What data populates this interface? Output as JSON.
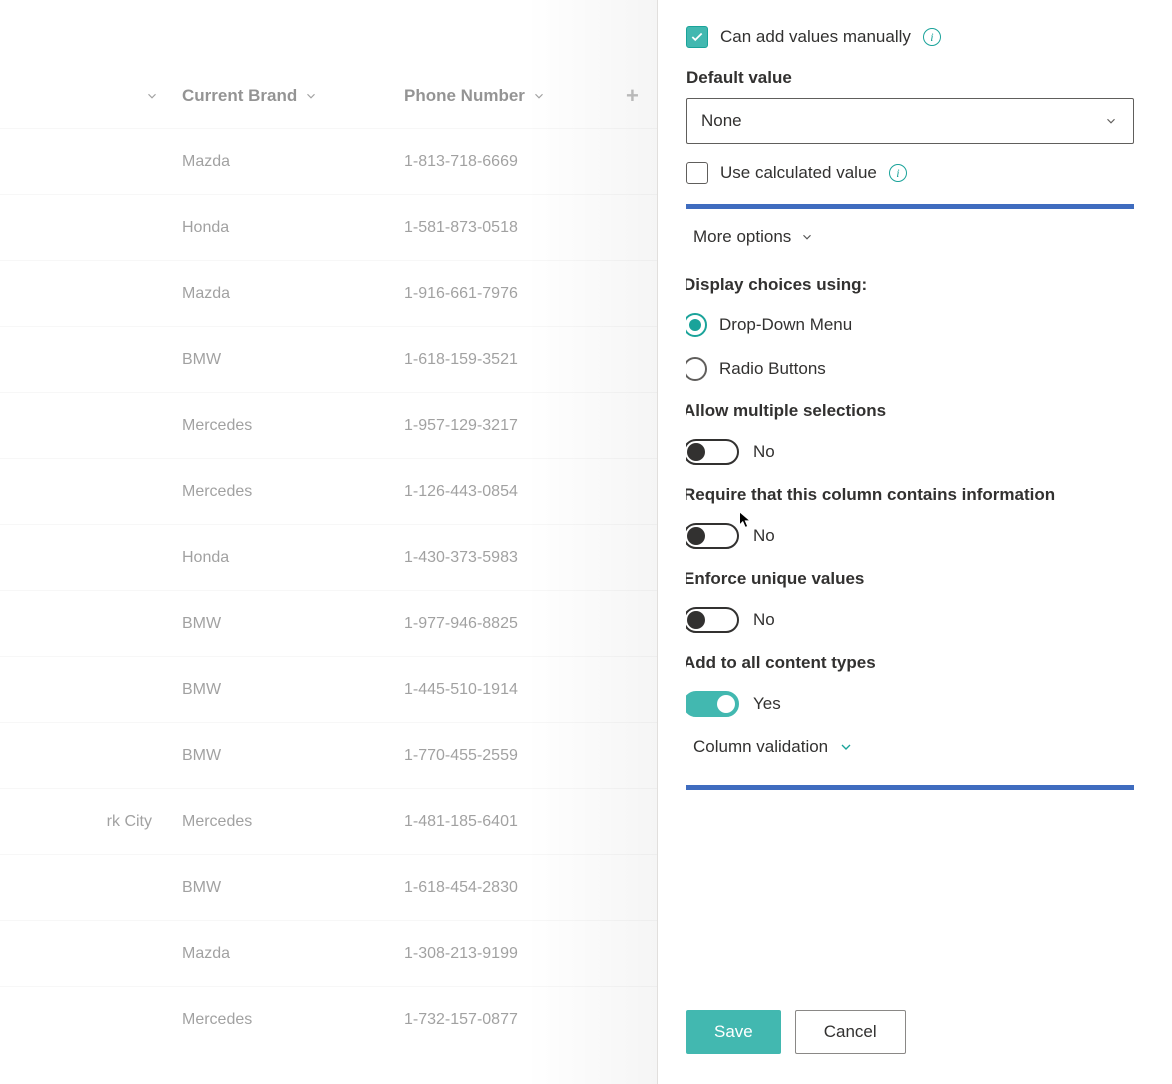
{
  "table": {
    "headers": {
      "brand": "Current Brand",
      "phone": "Phone Number"
    },
    "rows": [
      {
        "city": "",
        "brand": "Mazda",
        "phone": "1-813-718-6669"
      },
      {
        "city": "",
        "brand": "Honda",
        "phone": "1-581-873-0518"
      },
      {
        "city": "",
        "brand": "Mazda",
        "phone": "1-916-661-7976"
      },
      {
        "city": "",
        "brand": "BMW",
        "phone": "1-618-159-3521"
      },
      {
        "city": "",
        "brand": "Mercedes",
        "phone": "1-957-129-3217"
      },
      {
        "city": "",
        "brand": "Mercedes",
        "phone": "1-126-443-0854"
      },
      {
        "city": "",
        "brand": "Honda",
        "phone": "1-430-373-5983"
      },
      {
        "city": "",
        "brand": "BMW",
        "phone": "1-977-946-8825"
      },
      {
        "city": "",
        "brand": "BMW",
        "phone": "1-445-510-1914"
      },
      {
        "city": "",
        "brand": "BMW",
        "phone": "1-770-455-2559"
      },
      {
        "city": "rk City",
        "brand": "Mercedes",
        "phone": "1-481-185-6401"
      },
      {
        "city": "",
        "brand": "BMW",
        "phone": "1-618-454-2830"
      },
      {
        "city": "",
        "brand": "Mazda",
        "phone": "1-308-213-9199"
      },
      {
        "city": "",
        "brand": "Mercedes",
        "phone": "1-732-157-0877"
      }
    ]
  },
  "panel": {
    "manual_label": "Can add values manually",
    "default_value_label": "Default value",
    "default_value_selected": "None",
    "calculated_label": "Use calculated value",
    "more_options_label": "More options",
    "display_choices_label": "Display choices using:",
    "display_option_dropdown": "Drop-Down Menu",
    "display_option_radio": "Radio Buttons",
    "allow_multiple_label": "Allow multiple selections",
    "allow_multiple_value": "No",
    "require_label": "Require that this column contains information",
    "require_value": "No",
    "enforce_unique_label": "Enforce unique values",
    "enforce_unique_value": "No",
    "add_all_types_label": "Add to all content types",
    "add_all_types_value": "Yes",
    "column_validation_label": "Column validation",
    "save_label": "Save",
    "cancel_label": "Cancel"
  }
}
